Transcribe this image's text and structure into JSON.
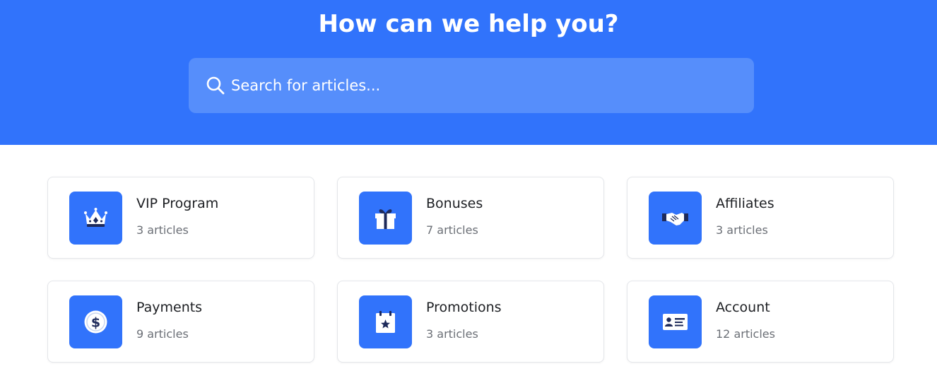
{
  "hero": {
    "title": "How can we help you?",
    "search_placeholder": "Search for articles...",
    "background_color": "#3173fb",
    "search_background_color": "#568efb"
  },
  "categories": [
    {
      "title": "VIP Program",
      "count": "3 articles",
      "icon": "crown-icon"
    },
    {
      "title": "Bonuses",
      "count": "7 articles",
      "icon": "gift-icon"
    },
    {
      "title": "Affiliates",
      "count": "3 articles",
      "icon": "handshake-icon"
    },
    {
      "title": "Payments",
      "count": "9 articles",
      "icon": "dollar-coin-icon"
    },
    {
      "title": "Promotions",
      "count": "3 articles",
      "icon": "calendar-star-icon"
    },
    {
      "title": "Account",
      "count": "12 articles",
      "icon": "id-card-icon"
    }
  ],
  "colors": {
    "accent": "#3173fb",
    "card_border": "#e4e6ea",
    "title_text": "#1d1f23",
    "muted_text": "#6b6f76"
  }
}
